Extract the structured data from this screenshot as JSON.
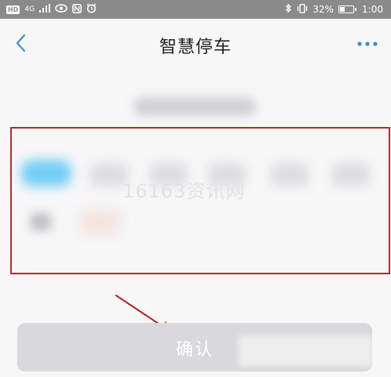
{
  "status_bar": {
    "hd_label": "HD",
    "network_label": "4G",
    "battery_percent": "32%",
    "time": "1:00",
    "icons": [
      "signal-icon",
      "eye-icon",
      "nfc-icon",
      "alarm-icon",
      "bluetooth-icon",
      "vibrate-icon",
      "battery-icon"
    ]
  },
  "nav": {
    "title": "智慧停车",
    "back_icon": "chevron-left-icon",
    "more_icon": "more-dots-icon"
  },
  "watermark": "16163资讯网",
  "confirm": {
    "label": "确认"
  },
  "colors": {
    "accent": "#3a8fd8",
    "highlight_border": "#b8292e",
    "active_cell": "#74cdf6",
    "arrow": "#b8292e"
  }
}
